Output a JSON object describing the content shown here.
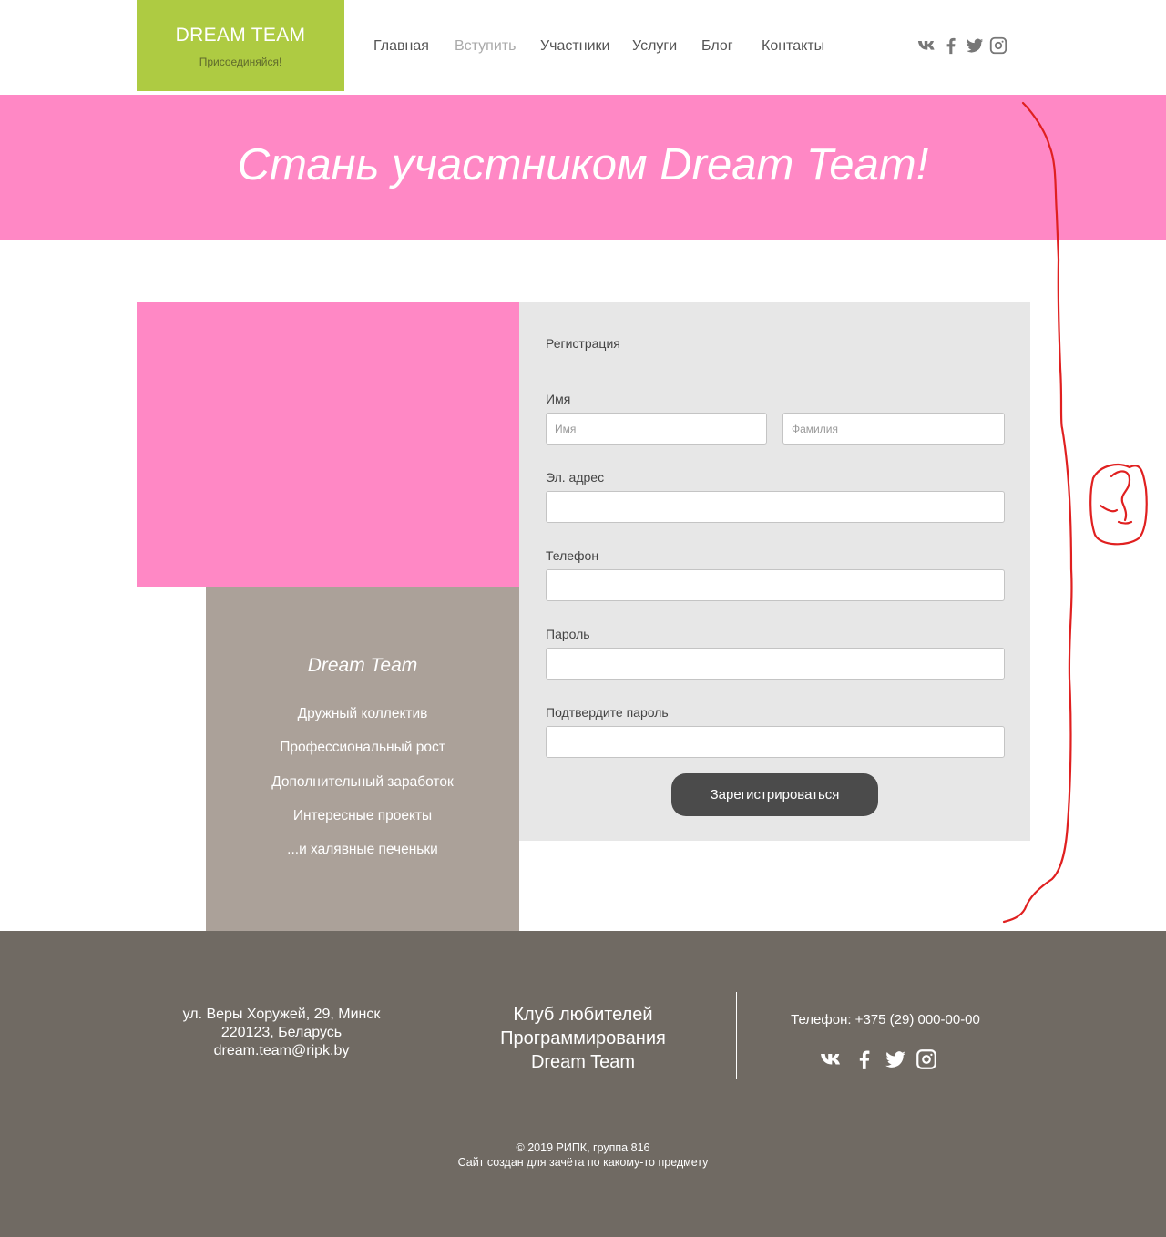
{
  "header": {
    "logo_title": "DREAM TEAM",
    "logo_subtitle": "Присоединяйся!",
    "nav": [
      {
        "label": "Главная",
        "active": false
      },
      {
        "label": "Вступить",
        "active": true
      },
      {
        "label": "Участники",
        "active": false
      },
      {
        "label": "Услуги",
        "active": false
      },
      {
        "label": "Блог",
        "active": false
      },
      {
        "label": "Контакты",
        "active": false
      }
    ],
    "social_icons": [
      "vk-icon",
      "facebook-icon",
      "twitter-icon",
      "instagram-icon"
    ]
  },
  "hero": {
    "title": "Стань участником Dream Team!"
  },
  "benefits": {
    "title": "Dream Team",
    "items": [
      "Дружный коллектив",
      "Профессиональный рост",
      "Дополнительный заработок",
      "Интересные проекты",
      "...и халявные печеньки"
    ]
  },
  "form": {
    "title": "Регистрация",
    "name_label": "Имя",
    "first_name_placeholder": "Имя",
    "last_name_placeholder": "Фамилия",
    "email_label": "Эл. адрес",
    "phone_label": "Телефон",
    "password_label": "Пароль",
    "confirm_label": "Подтвердите пароль",
    "submit_label": "Зарегистрироваться"
  },
  "annotation": {
    "color": "#e02020",
    "text": "?"
  },
  "footer": {
    "address_line1": "ул. Веры Хоружей, 29, Минск",
    "address_line2": "220123, Беларусь",
    "email": "dream.team@ripk.by",
    "club_line1": "Клуб любителей",
    "club_line2": "Программирования",
    "club_line3": "Dream Team",
    "phone": "Телефон: +375 (29) 000-00-00",
    "copyright": "© 2019 РИПК, группа 816",
    "note": "Сайт создан для зачёта по какому-то предмету"
  },
  "colors": {
    "logo_bg": "#aecb42",
    "pink": "#ff88c5",
    "taupe": "#aba199",
    "form_bg": "#e7e7e7",
    "footer_bg": "#706a63",
    "button_bg": "#4b4b4b"
  }
}
